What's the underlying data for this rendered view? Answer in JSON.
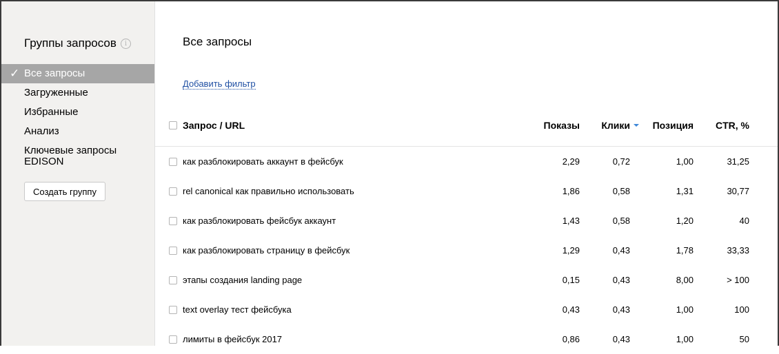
{
  "sidebar": {
    "title": "Группы запросов",
    "info_icon": "i",
    "items": [
      {
        "label": "Все запросы",
        "active": true
      },
      {
        "label": "Загруженные",
        "active": false
      },
      {
        "label": "Избранные",
        "active": false
      },
      {
        "label": "Анализ",
        "active": false
      },
      {
        "label": "Ключевые запросы EDISON",
        "active": false
      }
    ],
    "check_glyph": "✓",
    "create_button": "Создать группу"
  },
  "main": {
    "title": "Все запросы",
    "add_filter": "Добавить фильтр"
  },
  "table": {
    "columns": {
      "query": "Запрос / URL",
      "shows": "Показы",
      "clicks": "Клики",
      "position": "Позиция",
      "ctr": "CTR, %"
    },
    "sort_column": "clicks",
    "sort_color": "#3d87d8",
    "rows": [
      {
        "query": "как разблокировать аккаунт в фейсбук",
        "shows": "2,29",
        "clicks": "0,72",
        "position": "1,00",
        "ctr": "31,25"
      },
      {
        "query": "rel canonical как правильно использовать",
        "shows": "1,86",
        "clicks": "0,58",
        "position": "1,31",
        "ctr": "30,77"
      },
      {
        "query": "как разблокировать фейсбук аккаунт",
        "shows": "1,43",
        "clicks": "0,58",
        "position": "1,20",
        "ctr": "40"
      },
      {
        "query": "как разблокировать страницу в фейсбук",
        "shows": "1,29",
        "clicks": "0,43",
        "position": "1,78",
        "ctr": "33,33"
      },
      {
        "query": "этапы создания landing page",
        "shows": "0,15",
        "clicks": "0,43",
        "position": "8,00",
        "ctr": "> 100"
      },
      {
        "query": "text overlay тест фейсбука",
        "shows": "0,43",
        "clicks": "0,43",
        "position": "1,00",
        "ctr": "100"
      },
      {
        "query": "лимиты в фейсбук 2017",
        "shows": "0,86",
        "clicks": "0,43",
        "position": "1,00",
        "ctr": "50"
      }
    ]
  }
}
